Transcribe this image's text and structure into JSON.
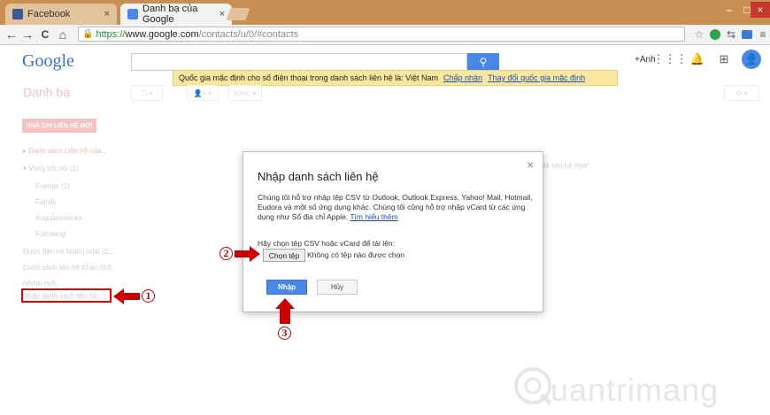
{
  "browser": {
    "tabs": [
      {
        "label": "Facebook",
        "favicon_color": "#3b5998",
        "close": "×"
      },
      {
        "label": "Danh bạ của Google",
        "favicon_color": "#4a86e8",
        "close": "×"
      }
    ],
    "window_controls": [
      "–",
      "□",
      "×"
    ],
    "nav": {
      "back": "←",
      "forward": "→",
      "reload": "C",
      "home": "⌂"
    },
    "url": {
      "scheme": "https://",
      "domain": "www.google.com",
      "path": "/contacts/u/0/#contacts"
    },
    "extensions": [
      "star-icon",
      "green-circle-icon",
      "sync-icon",
      "screen-icon",
      "menu-icon"
    ]
  },
  "header": {
    "logo": "Google",
    "search_placeholder": "",
    "search_icon": "🔍",
    "user_name": "+Anh",
    "country_banner": {
      "message": "Quốc gia mặc định cho số điện thoại trong danh sách liên hệ là: Việt Nam",
      "accept": "Chấp nhận",
      "change": "Thay đổi quốc gia mặc định"
    }
  },
  "page": {
    "title": "Danh bạ",
    "toolbar": {
      "more": "Khác"
    },
    "new_contact": "NHẬ CHI LIÊN HỆ MỚI",
    "sidebar": [
      {
        "label": "Danh sách Liên hệ của...",
        "style": "pink",
        "indent": false
      },
      {
        "label": "Vòng kết nối (1)",
        "style": "gray",
        "indent": false
      },
      {
        "label": "Friends (1)",
        "style": "gray",
        "indent": true
      },
      {
        "label": "Family",
        "style": "gray",
        "indent": true
      },
      {
        "label": "Acquaintances",
        "style": "gray",
        "indent": true
      },
      {
        "label": "Following",
        "style": "gray",
        "indent": true
      },
      {
        "label": "Được liên hệ Nhiều nhất (2...",
        "style": "gray",
        "indent": false
      },
      {
        "label": "Danh sách liên hệ Khác (93)",
        "style": "gray",
        "indent": false
      },
      {
        "label": "Nhóm mới...",
        "style": "gray",
        "indent": false
      },
      {
        "label": "Nhập danh sách liên hệ...",
        "style": "gray",
        "indent": false
      }
    ],
    "faded_note": "đề liên hệ mới\""
  },
  "dialog": {
    "title": "Nhập danh sách liên hệ",
    "close": "×",
    "description": "Chúng tôi hỗ trợ nhập tệp CSV từ Outlook, Outlook Express, Yahoo! Mail, Hotmail, Eudora và một số ứng dụng khác. Chúng tôi cũng hỗ trợ nhập vCard từ các ứng dụng như Sổ địa chỉ Apple.",
    "learn_more": "Tìm hiểu thêm",
    "prompt": "Hãy chọn tệp CSV hoặc vCard để tải lên:",
    "choose_file": "Chọn tệp",
    "no_file": "Không có tệp nào được chọn",
    "import": "Nhập",
    "cancel": "Hủy"
  },
  "annotations": {
    "step1": "1",
    "step2": "2",
    "step3": "3",
    "color": "#cc0000"
  },
  "watermark": "uantrimang"
}
